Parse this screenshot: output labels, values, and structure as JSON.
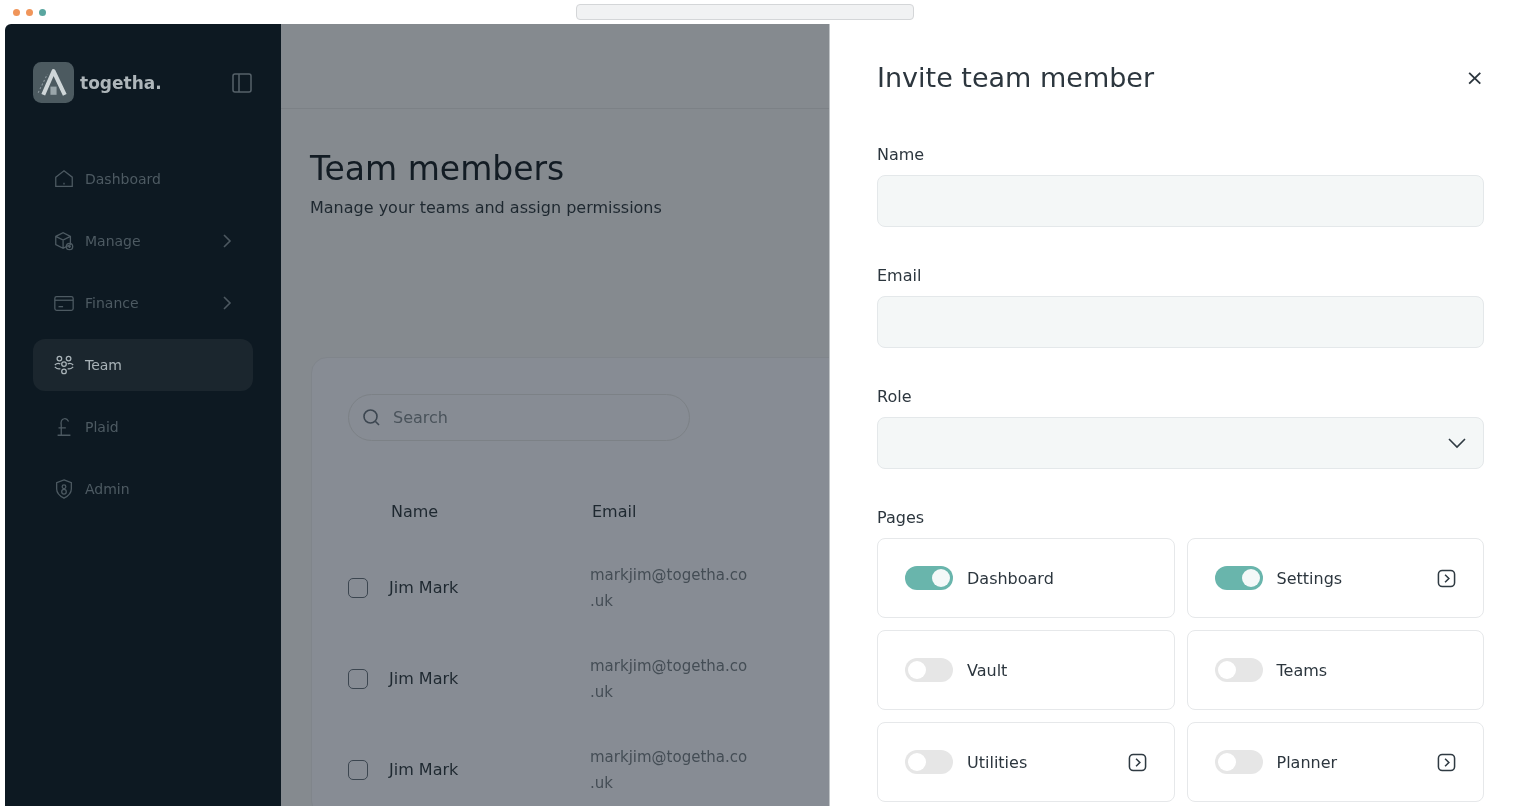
{
  "brand": {
    "name": "togetha."
  },
  "sidebar": {
    "items": [
      {
        "label": "Dashboard",
        "expandable": false,
        "selected": false
      },
      {
        "label": "Manage",
        "expandable": true,
        "selected": false
      },
      {
        "label": "Finance",
        "expandable": true,
        "selected": false
      },
      {
        "label": "Team",
        "expandable": false,
        "selected": true
      },
      {
        "label": "Plaid",
        "expandable": false,
        "selected": false
      },
      {
        "label": "Admin",
        "expandable": false,
        "selected": false
      }
    ]
  },
  "page": {
    "title": "Team members",
    "subtitle": "Manage your teams and assign permissions"
  },
  "search": {
    "placeholder": "Search"
  },
  "table": {
    "columns": [
      "Name",
      "Email"
    ],
    "rows": [
      {
        "checked": false,
        "name": "Jim Mark",
        "email": [
          "markjim@togetha.co",
          ".uk"
        ]
      },
      {
        "checked": false,
        "name": "Jim Mark",
        "email": [
          "markjim@togetha.co",
          ".uk"
        ]
      },
      {
        "checked": false,
        "name": "Jim Mark",
        "email": [
          "markjim@togetha.co",
          ".uk"
        ]
      }
    ]
  },
  "dialog": {
    "title": "Invite team member",
    "close": "×",
    "fields": [
      {
        "label": "Name",
        "kind": "text"
      },
      {
        "label": "Email",
        "kind": "text"
      },
      {
        "label": "Role",
        "kind": "select"
      }
    ],
    "pages_label": "Pages",
    "pages": [
      {
        "label": "Dashboard",
        "on": true,
        "has_link": false
      },
      {
        "label": "Settings",
        "on": true,
        "has_link": true
      },
      {
        "label": "Vault",
        "on": false,
        "has_link": false
      },
      {
        "label": "Teams",
        "on": false,
        "has_link": false
      },
      {
        "label": "Utilities",
        "on": false,
        "has_link": true
      },
      {
        "label": "Planner",
        "on": false,
        "has_link": true
      }
    ]
  }
}
